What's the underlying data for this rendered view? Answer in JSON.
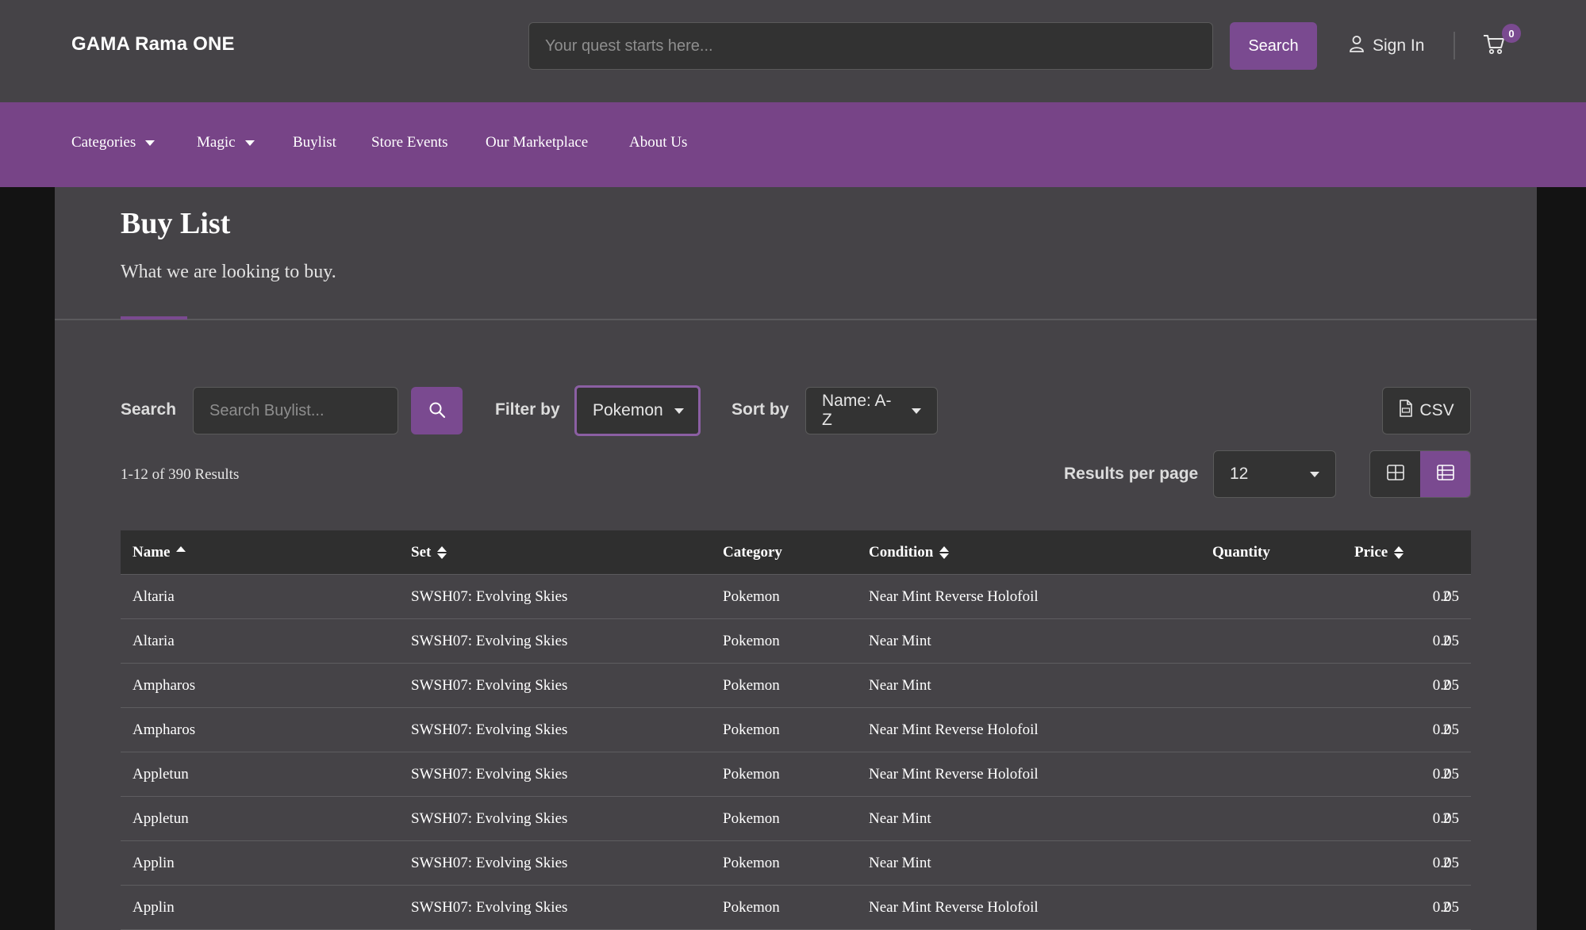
{
  "header": {
    "logo": "GAMA Rama ONE",
    "search_placeholder": "Your quest starts here...",
    "search_button": "Search",
    "sign_in": "Sign In",
    "cart_count": "0"
  },
  "nav": {
    "items": [
      {
        "label": "Categories",
        "dropdown": true
      },
      {
        "label": "Magic",
        "dropdown": true
      },
      {
        "label": "Buylist",
        "dropdown": false
      },
      {
        "label": "Store Events",
        "dropdown": false
      },
      {
        "label": "Our Marketplace",
        "dropdown": false
      },
      {
        "label": "About Us",
        "dropdown": false
      }
    ]
  },
  "page": {
    "title": "Buy List",
    "subtitle": "What we are looking to buy."
  },
  "controls": {
    "search_label": "Search",
    "search_placeholder": "Search Buylist...",
    "filter_label": "Filter by",
    "filter_value": "Pokemon",
    "sort_label": "Sort by",
    "sort_value": "Name: A-Z",
    "csv_label": "CSV",
    "results_count": "1-12 of 390 Results",
    "per_page_label": "Results per page",
    "per_page_value": "12",
    "active_view": "list"
  },
  "table": {
    "columns": [
      "Name",
      "Set",
      "Category",
      "Condition",
      "Quantity",
      "Price"
    ],
    "rows": [
      [
        "Altaria",
        "SWSH07: Evolving Skies",
        "Pokemon",
        "Near Mint Reverse Holofoil",
        "2",
        "0.05"
      ],
      [
        "Altaria",
        "SWSH07: Evolving Skies",
        "Pokemon",
        "Near Mint",
        "2",
        "0.05"
      ],
      [
        "Ampharos",
        "SWSH07: Evolving Skies",
        "Pokemon",
        "Near Mint",
        "2",
        "0.05"
      ],
      [
        "Ampharos",
        "SWSH07: Evolving Skies",
        "Pokemon",
        "Near Mint Reverse Holofoil",
        "2",
        "0.05"
      ],
      [
        "Appletun",
        "SWSH07: Evolving Skies",
        "Pokemon",
        "Near Mint Reverse Holofoil",
        "2",
        "0.05"
      ],
      [
        "Appletun",
        "SWSH07: Evolving Skies",
        "Pokemon",
        "Near Mint",
        "2",
        "0.05"
      ],
      [
        "Applin",
        "SWSH07: Evolving Skies",
        "Pokemon",
        "Near Mint",
        "2",
        "0.05"
      ],
      [
        "Applin",
        "SWSH07: Evolving Skies",
        "Pokemon",
        "Near Mint Reverse Holofoil",
        "2",
        "0.05"
      ]
    ]
  },
  "colors": {
    "accent": "#7a4a90",
    "nav_bg": "#774487",
    "panel_bg": "#454347",
    "page_bg": "#131313"
  },
  "icons": [
    "user-icon",
    "cart-icon",
    "search-icon",
    "file-csv-icon",
    "grid-view-icon",
    "list-view-icon",
    "sort-icon",
    "caret-down-icon"
  ]
}
